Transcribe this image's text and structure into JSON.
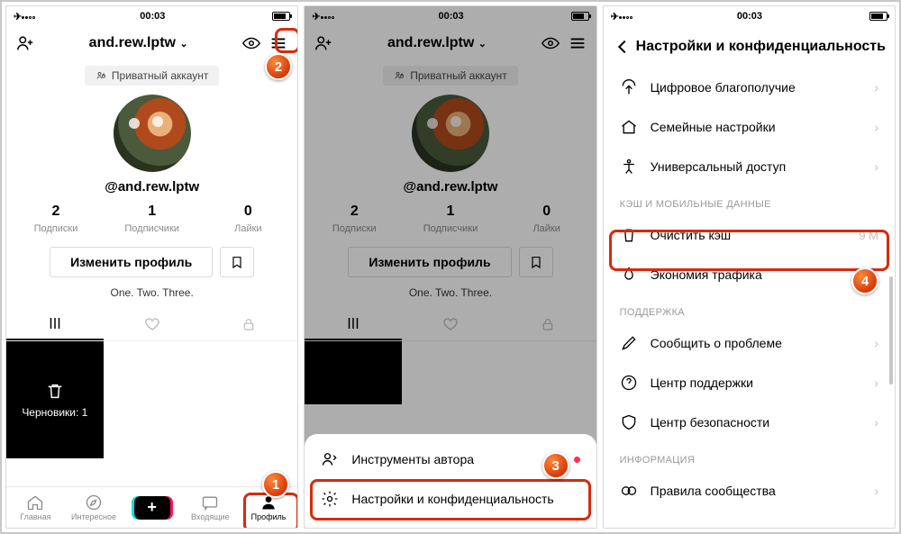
{
  "status": {
    "time": "00:03"
  },
  "profile": {
    "displayName": "and.rew.lptw",
    "handle": "@and.rew.lptw",
    "privateTag": "Приватный аккаунт",
    "bio": "One. Two. Three.",
    "editBtn": "Изменить профиль",
    "stats": [
      {
        "n": "2",
        "l": "Подписки"
      },
      {
        "n": "1",
        "l": "Подписчики"
      },
      {
        "n": "0",
        "l": "Лайки"
      }
    ],
    "drafts": "Черновики: 1"
  },
  "nav": {
    "home": "Главная",
    "discover": "Интересное",
    "inbox": "Входящие",
    "profile": "Профиль"
  },
  "sheet": {
    "tools": "Инструменты автора",
    "settings": "Настройки и конфиденциальность"
  },
  "settings": {
    "title": "Настройки и конфиденциальность",
    "wellbeing": "Цифровое благополучие",
    "family": "Семейные настройки",
    "accessibility": "Универсальный доступ",
    "secCache": "КЭШ И МОБИЛЬНЫЕ ДАННЫЕ",
    "clearCache": "Очистить кэш",
    "clearCacheVal": "9 М",
    "dataSaver": "Экономия трафика",
    "secSupport": "ПОДДЕРЖКА",
    "report": "Сообщить о проблеме",
    "help": "Центр поддержки",
    "safety": "Центр безопасности",
    "secInfo": "ИНФОРМАЦИЯ",
    "guidelines": "Правила сообщества"
  }
}
